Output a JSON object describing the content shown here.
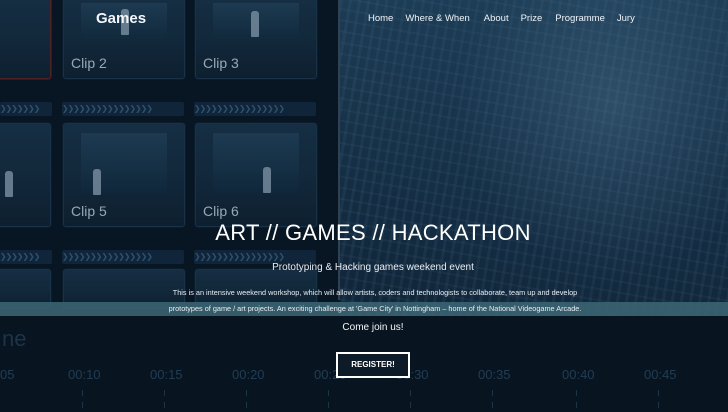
{
  "brand": {
    "name": "Games"
  },
  "nav": {
    "items": [
      {
        "label": "Home"
      },
      {
        "label": "Where & When"
      },
      {
        "label": "About"
      },
      {
        "label": "Prize"
      },
      {
        "label": "Programme"
      },
      {
        "label": "Jury"
      }
    ]
  },
  "editor_background": {
    "clips": [
      {
        "label": "Clip 2"
      },
      {
        "label": "Clip 3"
      },
      {
        "label": "Clip 5"
      },
      {
        "label": "Clip 6"
      }
    ],
    "track_name": "ne",
    "timecodes": [
      "05",
      "00:10",
      "00:15",
      "00:20",
      "00:25",
      "00:30",
      "00:35",
      "00:40",
      "00:45"
    ]
  },
  "hero": {
    "title": "ART // GAMES // HACKATHON",
    "subtitle": "Prototyping & Hacking games weekend event",
    "description_line1": "This is an intensive weekend workshop, which will allow artists, coders and technologists to collaborate, team up and develop",
    "description_line2": "prototypes of game / art projects. An exciting challenge at 'Game City' in Nottingham – home of the National Videogame Arcade.",
    "cta_text": "Come join us!",
    "register_label": "REGISTER!"
  },
  "colors": {
    "accent_band": "#4f8596",
    "button_border": "#ffffff",
    "background": "#0b1f33"
  }
}
